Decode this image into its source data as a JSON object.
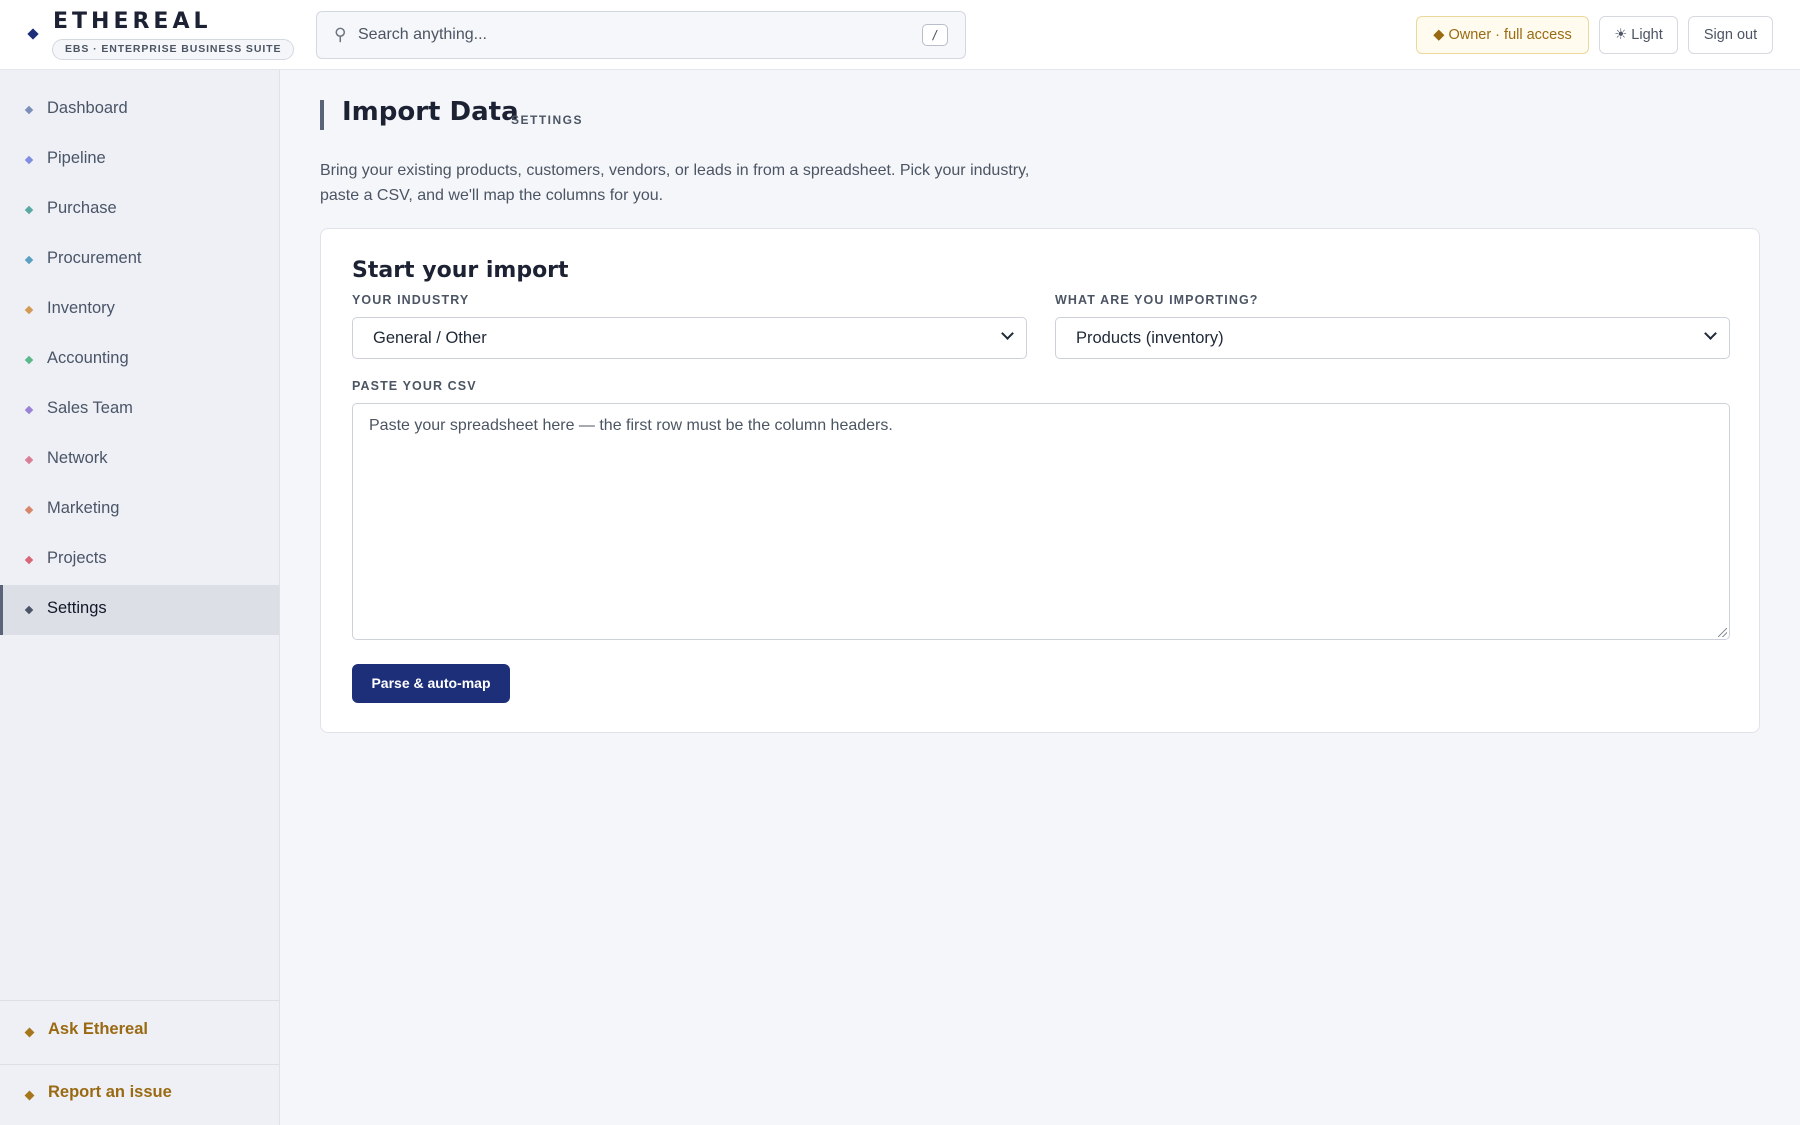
{
  "brand": {
    "name": "ETHEREAL",
    "tagline": "EBS · ENTERPRISE BUSINESS SUITE"
  },
  "search": {
    "placeholder": "Search anything...",
    "shortcut": "/"
  },
  "header_actions": {
    "owner_label": "◆ Owner · full access",
    "theme_label": "☀ Light",
    "signout_label": "Sign out"
  },
  "sidebar": {
    "items": [
      {
        "label": "Dashboard",
        "color": "#7b8fb8"
      },
      {
        "label": "Pipeline",
        "color": "#7f8ee0"
      },
      {
        "label": "Purchase",
        "color": "#5aa9a0"
      },
      {
        "label": "Procurement",
        "color": "#5aa0c0"
      },
      {
        "label": "Inventory",
        "color": "#d29b55"
      },
      {
        "label": "Accounting",
        "color": "#5cb88a"
      },
      {
        "label": "Sales Team",
        "color": "#9a82d6"
      },
      {
        "label": "Network",
        "color": "#d87f95"
      },
      {
        "label": "Marketing",
        "color": "#d8866a"
      },
      {
        "label": "Projects",
        "color": "#d86878"
      },
      {
        "label": "Settings",
        "color": "#4a5466",
        "active": true
      }
    ],
    "footer": {
      "ask_label": "Ask Ethereal",
      "report_label": "Report an issue"
    }
  },
  "page": {
    "title": "Import Data",
    "section": "SETTINGS",
    "description": "Bring your existing products, customers, vendors, or leads in from a spreadsheet. Pick your industry, paste a CSV, and we'll map the columns for you."
  },
  "import_card": {
    "title": "Start your import",
    "industry_label": "YOUR INDUSTRY",
    "industry_value": "General / Other",
    "importing_label": "WHAT ARE YOU IMPORTING?",
    "importing_value": "Products (inventory)",
    "csv_label": "PASTE YOUR CSV",
    "csv_placeholder": "Paste your spreadsheet here — the first row must be the column headers.",
    "parse_button": "Parse & auto-map"
  },
  "colors": {
    "accent": "#1e2f7a",
    "gold": "#9a6a13"
  }
}
